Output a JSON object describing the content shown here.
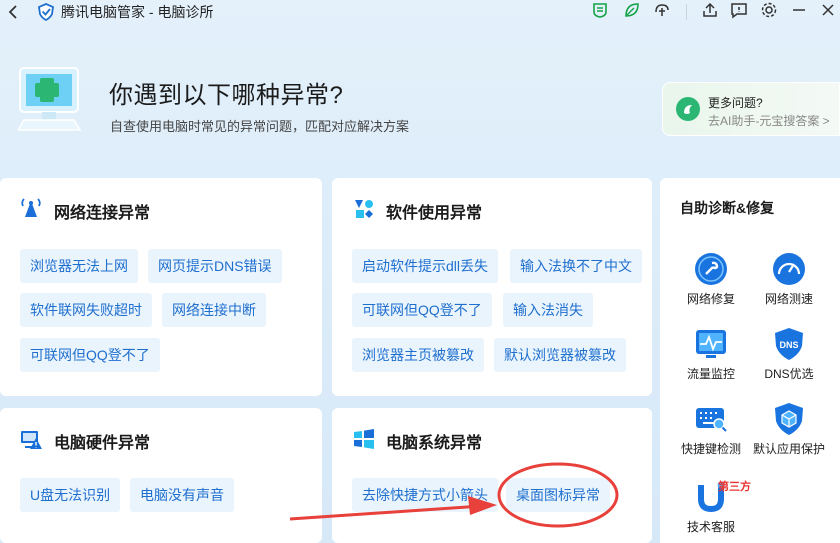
{
  "window": {
    "title": "腾讯电脑管家 - 电脑诊所"
  },
  "titlebar_icons": [
    "back-icon",
    "security-badge-icon",
    "leaf-icon",
    "cloud-fan-icon",
    "upload-icon",
    "feedback-icon",
    "settings-icon",
    "minimize-icon",
    "close-icon"
  ],
  "hero": {
    "title": "你遇到以下哪种异常?",
    "subtitle": "自查使用电脑时常见的异常问题，匹配对应解决方案"
  },
  "ai_card": {
    "title": "更多问题?",
    "subtitle": "去AI助手-元宝搜答案 >"
  },
  "cards": {
    "network": {
      "title": "网络连接异常",
      "chips": [
        "浏览器无法上网",
        "网页提示DNS错误",
        "软件联网失败超时",
        "网络连接中断",
        "可联网但QQ登不了"
      ]
    },
    "software": {
      "title": "软件使用异常",
      "chips": [
        "启动软件提示dll丢失",
        "输入法换不了中文",
        "可联网但QQ登不了",
        "输入法消失",
        "浏览器主页被篡改",
        "默认浏览器被篡改"
      ]
    },
    "hardware": {
      "title": "电脑硬件异常",
      "chips": [
        "U盘无法识别",
        "电脑没有声音"
      ]
    },
    "system": {
      "title": "电脑系统异常",
      "chips": [
        "去除快捷方式小箭头",
        "桌面图标异常"
      ]
    }
  },
  "sidebar": {
    "title": "自助诊断&修复",
    "tools": [
      "网络修复",
      "网络测速",
      "流量监控",
      "DNS优选",
      "快捷键检测",
      "默认应用保护",
      "技术客服"
    ],
    "dns_icon_text": "DNS",
    "badge": "第三方"
  },
  "colors": {
    "accent": "#1f6fce",
    "chip_bg": "#eaf4fd",
    "annotation": "#e8403a"
  }
}
